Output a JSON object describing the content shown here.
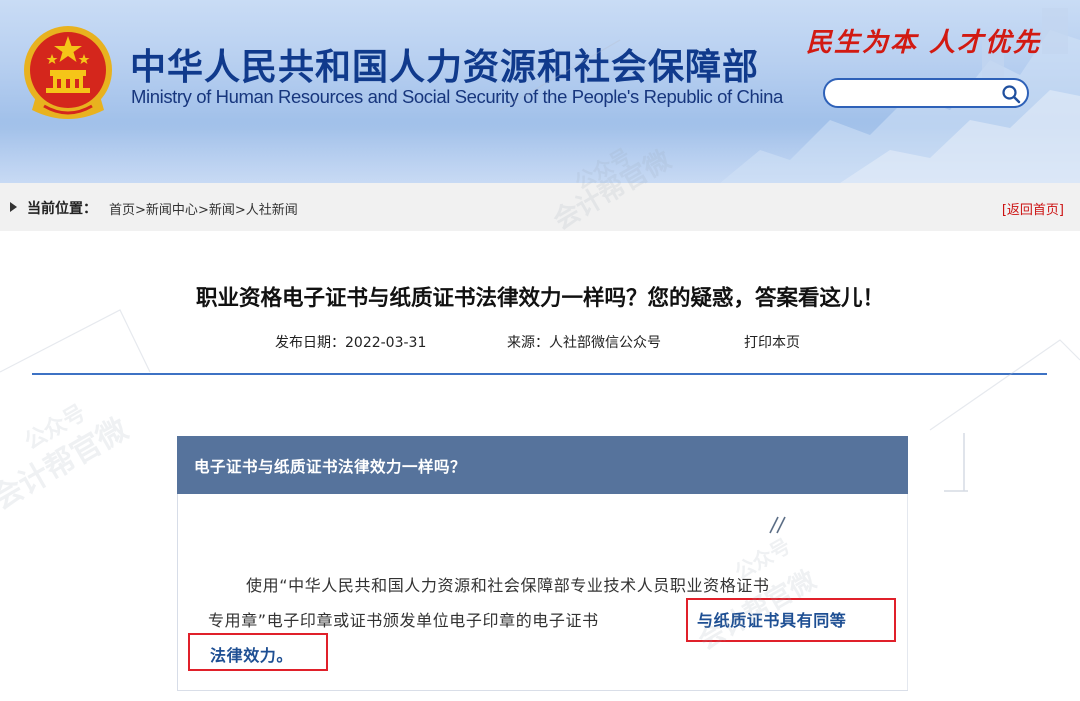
{
  "header": {
    "title": "中华人民共和国人力资源和社会保障部",
    "subtitle": "Ministry of Human Resources and Social Security of the People's Republic of China",
    "slogan": "民生为本 人才优先",
    "search": {
      "value": "",
      "placeholder": ""
    }
  },
  "breadcrumb": {
    "label": "当前位置：",
    "items": [
      "首页",
      "新闻中心",
      "新闻",
      "人社新闻"
    ],
    "separator": ">",
    "back_home": "[返回首页]"
  },
  "article": {
    "title": "职业资格电子证书与纸质证书法律效力一样吗？您的疑惑，答案看这儿！",
    "date": "发布日期：2022-03-31",
    "source": "来源：人社部微信公众号",
    "print": "打印本页",
    "question": "电子证书与纸质证书法律效力一样吗？",
    "body": {
      "line1": "使用“中华人民共和国人力资源和社会保障部专业技术人员职业资格证书",
      "line2": "专用章”电子印章或证书颁发单位电子印章的电子证书",
      "line2_highlight": "与纸质证书具有同等",
      "line3_highlight": "法律效力。"
    }
  },
  "watermarks": [
    "公众号",
    "会计帮官微"
  ],
  "colors": {
    "header_text": "#103a8c",
    "slogan": "#d21a12",
    "divider": "#3d72c4",
    "question_bar": "#56739c",
    "highlight_text": "#1e4f93",
    "highlight_box": "#e0202a",
    "back_home": "#cc1111"
  },
  "icons": {
    "emblem": "national-emblem-icon",
    "search": "search-icon",
    "crumb": "triangle-right-icon"
  }
}
